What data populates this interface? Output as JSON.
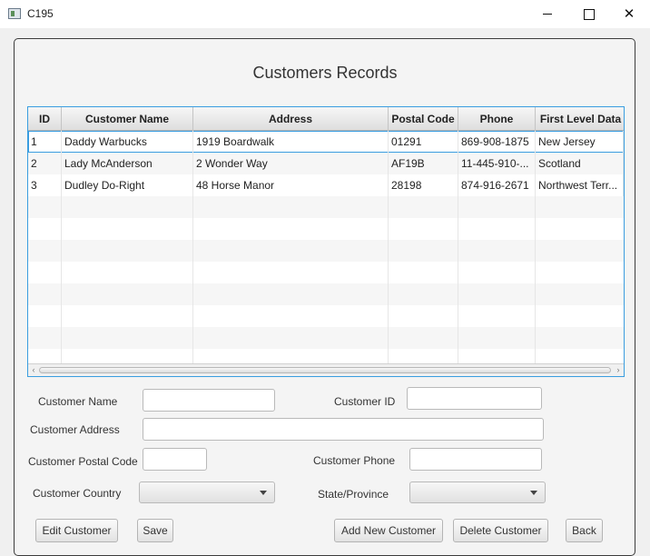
{
  "window": {
    "title": "C195"
  },
  "page": {
    "title": "Customers Records"
  },
  "table": {
    "columns": [
      "ID",
      "Customer Name",
      "Address",
      "Postal Code",
      "Phone",
      "First Level Data"
    ],
    "rows": [
      [
        "1",
        "Daddy Warbucks",
        "1919 Boardwalk",
        "01291",
        "869-908-1875",
        "New Jersey"
      ],
      [
        "2",
        "Lady McAnderson",
        "2 Wonder Way",
        "AF19B",
        "11-445-910-...",
        "Scotland"
      ],
      [
        "3",
        "Dudley Do-Right",
        "48 Horse Manor",
        "28198",
        "874-916-2671",
        "Northwest Terr..."
      ]
    ],
    "selected_row": 0
  },
  "form": {
    "customer_name_label": "Customer Name",
    "customer_name_value": "",
    "customer_id_label": "Customer ID",
    "customer_id_value": "",
    "customer_address_label": "Customer Address",
    "customer_address_value": "",
    "customer_postal_code_label": "Customer Postal Code",
    "customer_postal_code_value": "",
    "customer_phone_label": "Customer Phone",
    "customer_phone_value": "",
    "customer_country_label": "Customer Country",
    "customer_country_value": "",
    "state_province_label": "State/Province",
    "state_province_value": ""
  },
  "buttons": {
    "edit_customer": "Edit Customer",
    "save": "Save",
    "add_new_customer": "Add New Customer",
    "delete_customer": "Delete Customer",
    "back": "Back"
  },
  "icons": {
    "app": "app-window-icon",
    "minimize": "minimize-icon",
    "maximize": "maximize-icon",
    "close": "close-icon",
    "dropdown": "chevron-down-icon",
    "scroll_left": "scroll-left-icon",
    "scroll_right": "scroll-right-icon"
  }
}
